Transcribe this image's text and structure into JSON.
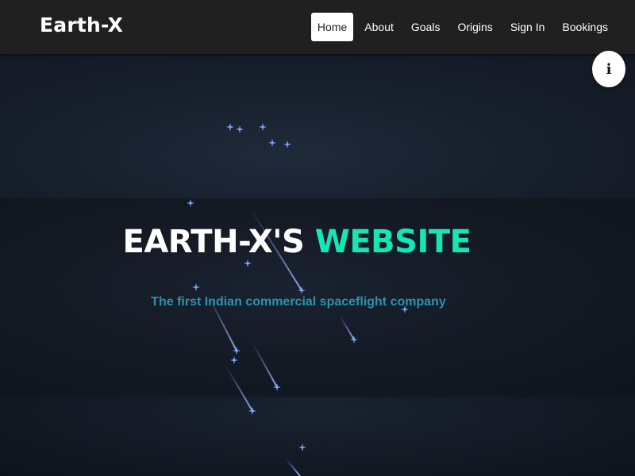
{
  "navbar": {
    "brand": "Earth-X",
    "links": [
      {
        "label": "Home",
        "active": true
      },
      {
        "label": "About"
      },
      {
        "label": "Goals"
      },
      {
        "label": "Origins"
      },
      {
        "label": "Sign In"
      },
      {
        "label": "Bookings"
      }
    ]
  },
  "info_button": {
    "icon": "info-icon",
    "glyph": "i"
  },
  "hero": {
    "title_main": "EARTH-X'S ",
    "title_accent": "WEBSITE",
    "subtitle": "The first Indian commercial spaceflight company"
  },
  "colors": {
    "navbar_bg": "#202020",
    "accent": "#16e6b6",
    "subtitle": "#2a93ad",
    "star": "#6e9cff"
  }
}
